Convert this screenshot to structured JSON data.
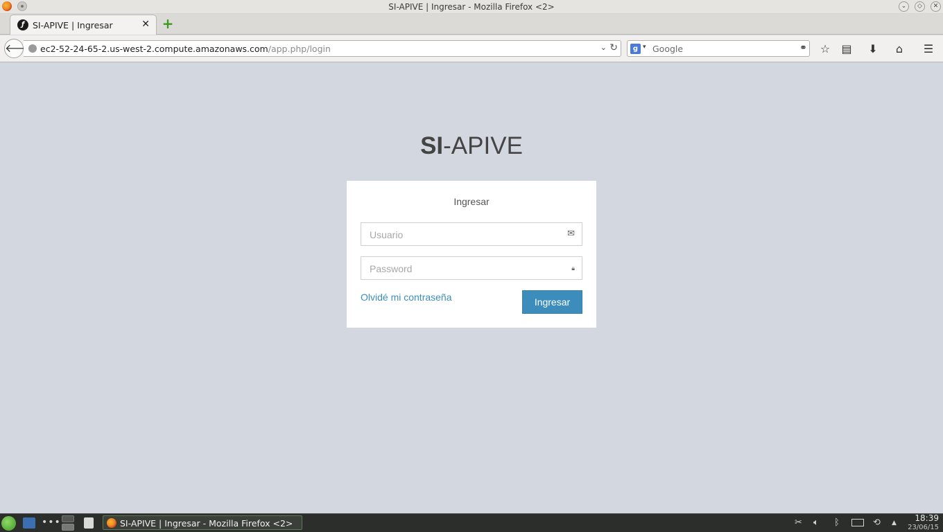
{
  "window": {
    "title": "SI-APIVE | Ingresar - Mozilla Firefox <2>"
  },
  "tabs": [
    {
      "label": "SI-APIVE | Ingresar"
    }
  ],
  "navbar": {
    "url_host": "ec2-52-24-65-2.us-west-2.compute.amazonaws.com",
    "url_path": "/app.php/login",
    "search_placeholder": "Google"
  },
  "login": {
    "brand_bold": "SI",
    "brand_rest": "-APIVE",
    "title": "Ingresar",
    "username_placeholder": "Usuario",
    "password_placeholder": "Password",
    "forgot_label": "Olvidé mi contraseña",
    "submit_label": "Ingresar"
  },
  "taskbar": {
    "task_label": "SI-APIVE | Ingresar - Mozilla Firefox <2>",
    "time": "18:39",
    "date": "23/06/15"
  },
  "colors": {
    "page_bg": "#d2d7e0",
    "accent": "#3c8dbc"
  }
}
